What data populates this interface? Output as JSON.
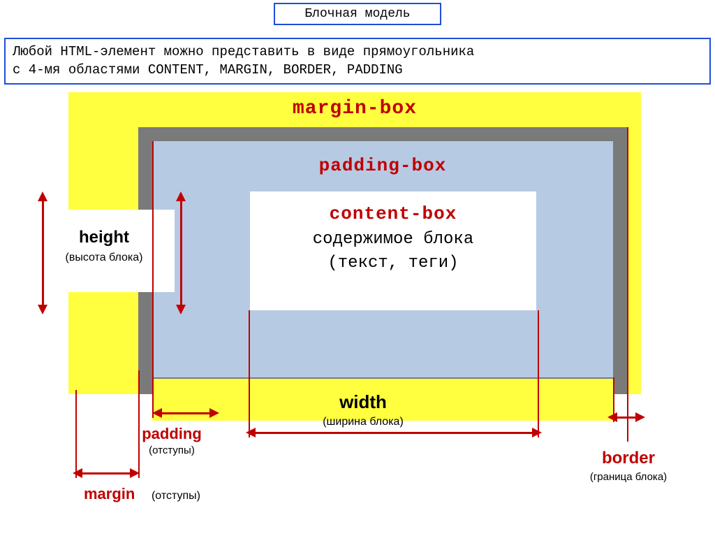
{
  "title": "Блочная модель",
  "intro_line1_a": "Любой ",
  "intro_line1_b": "HTML",
  "intro_line1_c": "-элемент можно представить в виде прямоугольника",
  "intro_line2_a": "с 4-мя областями  ",
  "intro_line2_b": "content,  margin, border, padding",
  "labels": {
    "margin_box": "margin-box",
    "padding_box": "padding-box",
    "content_box": "content-box",
    "content_desc1": "содержимое блока",
    "content_desc2": "(текст, теги)"
  },
  "callouts": {
    "height_main": "height",
    "height_sub": "(высота блока)",
    "width_main": "width",
    "width_sub": "(ширина блока)",
    "padding_main": "padding",
    "padding_sub": "(отступы)",
    "margin_main": "margin",
    "margin_sub": "(отступы)",
    "border_main": "border",
    "border_sub": "(граница блока)"
  }
}
